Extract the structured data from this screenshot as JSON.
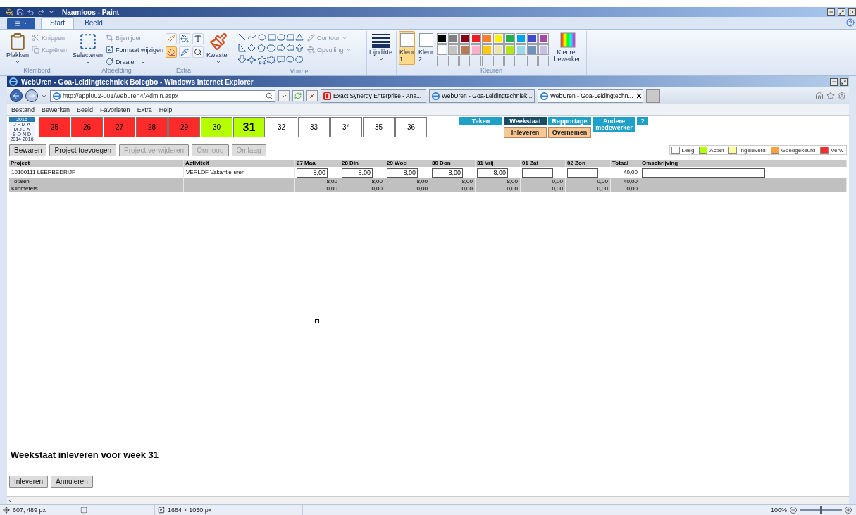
{
  "paint": {
    "title": "Naamloos - Paint",
    "tabs": [
      {
        "label": "Start",
        "selected": true
      },
      {
        "label": "Beeld",
        "selected": false
      }
    ],
    "clipboard": {
      "label": "Klembord",
      "paste": "Plakken",
      "cut": "Knippen",
      "copy": "Kopiëren"
    },
    "image": {
      "label": "Afbeelding",
      "select": "Selecteren",
      "crop": "Bijsnijden",
      "resize": "Formaat wijzigen",
      "rotate": "Draaien"
    },
    "tools": {
      "label": "Extra",
      "items": [
        {
          "kind": "pencil",
          "selected": false
        },
        {
          "kind": "fill",
          "selected": false
        },
        {
          "kind": "text",
          "selected": false
        },
        {
          "kind": "eraser",
          "selected": true
        },
        {
          "kind": "picker",
          "selected": false
        },
        {
          "kind": "magnifier",
          "selected": false
        }
      ]
    },
    "brushes": "Kwasten",
    "shapes": {
      "label": "Vormen",
      "outline": "Contour",
      "fill": "Opvulling"
    },
    "size": "Lijndikte",
    "color_slots": [
      {
        "label": "Kleur",
        "number": "1",
        "selected": true
      },
      {
        "label": "Kleur",
        "number": "2",
        "selected": false
      }
    ],
    "colors": {
      "label": "Kleuren",
      "edit": "Kleuren bewerken",
      "swatches": [
        {
          "color": "#000000"
        },
        {
          "color": "#7f7f7f"
        },
        {
          "color": "#880015"
        },
        {
          "color": "#ed1c24"
        },
        {
          "color": "#ff7f27"
        },
        {
          "color": "#fff200"
        },
        {
          "color": "#22b14c"
        },
        {
          "color": "#00a2e8"
        },
        {
          "color": "#3f48cc"
        },
        {
          "color": "#a349a4"
        },
        {
          "color": "#ffffff"
        },
        {
          "color": "#c3c3c3"
        },
        {
          "color": "#b97a57"
        },
        {
          "color": "#ffaec9"
        },
        {
          "color": "#ffc90e"
        },
        {
          "color": "#efe4b0"
        },
        {
          "color": "#b5e61d"
        },
        {
          "color": "#99d9ea"
        },
        {
          "color": "#7092be"
        },
        {
          "color": "#c8bfe7"
        }
      ]
    },
    "status": {
      "position": "607, 489 px",
      "size": "1684 × 1050 px",
      "zoom": "100%",
      "level": 0.5
    }
  },
  "browser": {
    "title": "WebUren - Goa-Leidingtechniek Bolegbo - Windows Internet Explorer",
    "address": "http://appl002-001/weburen4/Admin.aspx",
    "tabs": [
      {
        "label": "Exact Synergy Enterprise - Ana...",
        "kind": "exact",
        "selected": false
      },
      {
        "label": "WebUren - Goa-Leidingtechniek ...",
        "kind": "ie",
        "selected": false
      },
      {
        "label": "WebUren - Goa-Leidingtechn...",
        "kind": "ie",
        "selected": true
      }
    ],
    "menu": [
      "Bestand",
      "Bewerken",
      "Beeld",
      "Favorieten",
      "Extra",
      "Help"
    ]
  },
  "page": {
    "calendar": {
      "year": "2015",
      "rows": [
        "J F M A",
        "M J J A",
        "S O N D"
      ],
      "prev": "2014",
      "next": "2016"
    },
    "weeks": [
      {
        "label": "25",
        "color": "#ff2a2a",
        "selected": false
      },
      {
        "label": "26",
        "color": "#ff2a2a",
        "selected": false
      },
      {
        "label": "27",
        "color": "#ff2a2a",
        "selected": false
      },
      {
        "label": "28",
        "color": "#ff2a2a",
        "selected": false
      },
      {
        "label": "29",
        "color": "#ff2a2a",
        "selected": false
      },
      {
        "label": "30",
        "color": "#b5ff00",
        "selected": false
      },
      {
        "label": "31",
        "color": "#b5ff00",
        "selected": true
      },
      {
        "label": "32",
        "color": "#ffffff",
        "selected": false
      },
      {
        "label": "33",
        "color": "#ffffff",
        "selected": false
      },
      {
        "label": "34",
        "color": "#ffffff",
        "selected": false
      },
      {
        "label": "35",
        "color": "#ffffff",
        "selected": false
      },
      {
        "label": "36",
        "color": "#ffffff",
        "selected": false
      }
    ],
    "nav": [
      {
        "label": "Taken",
        "selected": false
      },
      {
        "label": "Weekstaat",
        "selected": true
      },
      {
        "label": "Rapportage",
        "selected": false
      },
      {
        "label": "Andere medewerker",
        "selected": false
      },
      {
        "label": "?",
        "selected": false
      }
    ],
    "subnav": [
      "Inleveren",
      "Overnemen"
    ],
    "buttons": [
      {
        "label": "Bewaren",
        "disabled": false
      },
      {
        "label": "Project toevoegen",
        "disabled": false
      },
      {
        "label": "Project verwijderen",
        "disabled": true
      },
      {
        "label": "Omhoog",
        "disabled": true
      },
      {
        "label": "Omlaag",
        "disabled": true
      }
    ],
    "legend": [
      {
        "label": "Leeg",
        "color": "#ffffff"
      },
      {
        "label": "Actief",
        "color": "#b5ff00"
      },
      {
        "label": "Ingeleverd",
        "color": "#ffff99"
      },
      {
        "label": "Goedgekeurd",
        "color": "#ffa040"
      },
      {
        "label": "Verw",
        "color": "#ff2a2a"
      }
    ],
    "table": {
      "columns": [
        "Project",
        "Activiteit",
        "27 Maa",
        "28 Din",
        "29 Woe",
        "30 Don",
        "31 Vrij",
        "01 Zat",
        "02 Zon",
        "Totaal",
        "Omschrijving"
      ],
      "rows": [
        {
          "project": "10100111 LEERBEDRIJF",
          "activity": "VERLOF Vakantie-uren",
          "hours": [
            "8,00",
            "8,00",
            "8,00",
            "8,00",
            "8,00"
          ],
          "total": "40,00"
        }
      ],
      "totals": [
        {
          "label": "Totalen",
          "values": [
            "8,00",
            "8,00",
            "8,00",
            "8,00",
            "8,00",
            "0,00",
            "0,00"
          ],
          "total": "40,00"
        },
        {
          "label": "Kilometers",
          "values": [
            "0,00",
            "0,00",
            "0,00",
            "0,00",
            "0,00",
            "0,00",
            "0,00"
          ],
          "total": "0,00"
        }
      ]
    },
    "footer": {
      "heading": "Weekstaat inleveren voor week 31",
      "buttons": [
        "Inleveren",
        "Annuleren"
      ]
    }
  }
}
